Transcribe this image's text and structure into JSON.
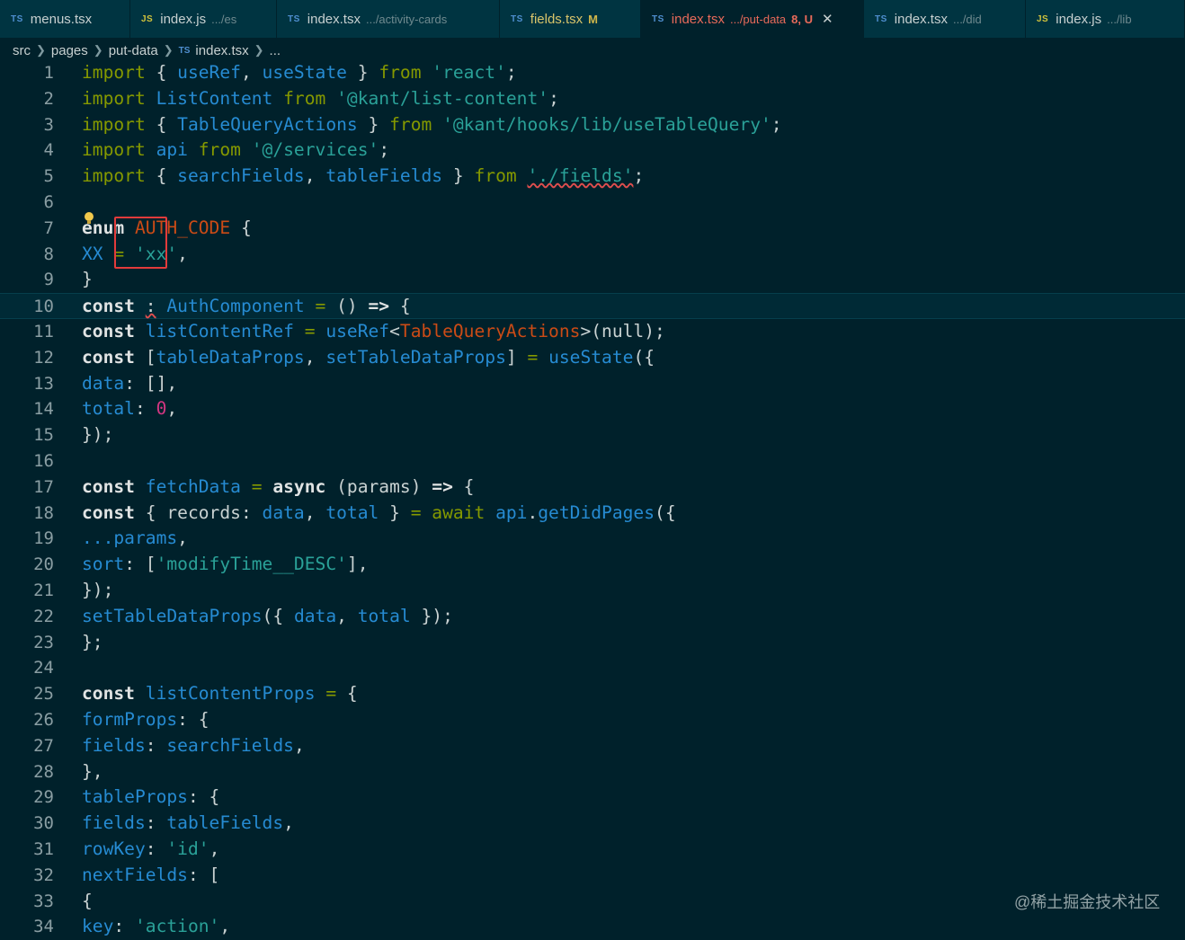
{
  "tabs": [
    {
      "lang": "TS",
      "name": "menus.tsx",
      "dir": "",
      "badge": "",
      "active": false
    },
    {
      "lang": "JS",
      "name": "index.js",
      "dir": ".../es",
      "badge": "",
      "active": false
    },
    {
      "lang": "TS",
      "name": "index.tsx",
      "dir": ".../activity-cards",
      "badge": "",
      "active": false
    },
    {
      "lang": "TS",
      "name": "fields.tsx",
      "dir": "",
      "badge": "M",
      "active": false
    },
    {
      "lang": "TS",
      "name": "index.tsx",
      "dir": ".../put-data",
      "badge": "8, U",
      "active": true
    },
    {
      "lang": "TS",
      "name": "index.tsx",
      "dir": ".../did",
      "badge": "",
      "active": false
    },
    {
      "lang": "JS",
      "name": "index.js",
      "dir": ".../lib",
      "badge": "",
      "active": false
    }
  ],
  "colors": {
    "modified": "#d0b64a",
    "error_tab": "#e86a5a",
    "fields_tab": "#d8c46a"
  },
  "breadcrumb": {
    "items": [
      "src",
      "pages",
      "put-data"
    ],
    "file_lang": "TS",
    "file": "index.tsx",
    "ellipsis": "..."
  },
  "code_lines": [
    [
      [
        "k",
        "import"
      ],
      [
        "p",
        " { "
      ],
      [
        "i",
        "useRef"
      ],
      [
        "p",
        ", "
      ],
      [
        "i",
        "useState"
      ],
      [
        "p",
        " } "
      ],
      [
        "k",
        "from"
      ],
      [
        "p",
        " "
      ],
      [
        "s",
        "'react'"
      ],
      [
        "p",
        ";"
      ]
    ],
    [
      [
        "k",
        "import"
      ],
      [
        "p",
        " "
      ],
      [
        "i",
        "ListContent"
      ],
      [
        "p",
        " "
      ],
      [
        "k",
        "from"
      ],
      [
        "p",
        " "
      ],
      [
        "s",
        "'@kant/list-content'"
      ],
      [
        "p",
        ";"
      ]
    ],
    [
      [
        "k",
        "import"
      ],
      [
        "p",
        " { "
      ],
      [
        "i",
        "TableQueryActions"
      ],
      [
        "p",
        " } "
      ],
      [
        "k",
        "from"
      ],
      [
        "p",
        " "
      ],
      [
        "s",
        "'@kant/hooks/lib/useTableQuery'"
      ],
      [
        "p",
        ";"
      ]
    ],
    [
      [
        "k",
        "import"
      ],
      [
        "p",
        " "
      ],
      [
        "i",
        "api"
      ],
      [
        "p",
        " "
      ],
      [
        "k",
        "from"
      ],
      [
        "p",
        " "
      ],
      [
        "s",
        "'@/services'"
      ],
      [
        "p",
        ";"
      ]
    ],
    [
      [
        "k",
        "import"
      ],
      [
        "p",
        " { "
      ],
      [
        "i",
        "searchFields"
      ],
      [
        "p",
        ", "
      ],
      [
        "i",
        "tableFields"
      ],
      [
        "p",
        " } "
      ],
      [
        "k",
        "from"
      ],
      [
        "p",
        " "
      ],
      [
        "s wav",
        "'./fields'"
      ],
      [
        "p",
        ";"
      ]
    ],
    [],
    [
      [
        "b",
        "enum"
      ],
      [
        "p",
        " "
      ],
      [
        "o",
        "AUTH_CODE"
      ],
      [
        "p",
        " {"
      ]
    ],
    [
      [
        "i",
        "XX"
      ],
      [
        "p",
        " "
      ],
      [
        "k",
        "="
      ],
      [
        "p",
        " "
      ],
      [
        "s",
        "'xx'"
      ],
      [
        "p",
        ","
      ]
    ],
    [
      [
        "p",
        "}"
      ]
    ],
    [
      [
        "b",
        "const"
      ],
      [
        "p",
        " "
      ],
      [
        "p wav",
        ":"
      ],
      [
        "p",
        " "
      ],
      [
        "i",
        "AuthComponent"
      ],
      [
        "p",
        " "
      ],
      [
        "k",
        "="
      ],
      [
        "p",
        " () "
      ],
      [
        "b",
        "=>"
      ],
      [
        "p",
        " {"
      ]
    ],
    [
      [
        "b",
        "const"
      ],
      [
        "p",
        " "
      ],
      [
        "i",
        "listContentRef"
      ],
      [
        "p",
        " "
      ],
      [
        "k",
        "="
      ],
      [
        "p",
        " "
      ],
      [
        "i",
        "useRef"
      ],
      [
        "p",
        "<"
      ],
      [
        "o",
        "TableQueryActions"
      ],
      [
        "p",
        ">(null);"
      ]
    ],
    [
      [
        "b",
        "const"
      ],
      [
        "p",
        " ["
      ],
      [
        "i",
        "tableDataProps"
      ],
      [
        "p",
        ", "
      ],
      [
        "i",
        "setTableDataProps"
      ],
      [
        "p",
        "] "
      ],
      [
        "k",
        "="
      ],
      [
        "p",
        " "
      ],
      [
        "i",
        "useState"
      ],
      [
        "p",
        "({"
      ]
    ],
    [
      [
        "i",
        "data"
      ],
      [
        "p",
        ": [],"
      ]
    ],
    [
      [
        "i",
        "total"
      ],
      [
        "p",
        ": "
      ],
      [
        "n",
        "0"
      ],
      [
        "p",
        ","
      ]
    ],
    [
      [
        "p",
        "});"
      ]
    ],
    [],
    [
      [
        "b",
        "const"
      ],
      [
        "p",
        " "
      ],
      [
        "i",
        "fetchData"
      ],
      [
        "p",
        " "
      ],
      [
        "k",
        "="
      ],
      [
        "p",
        " "
      ],
      [
        "b",
        "async"
      ],
      [
        "p",
        " (params) "
      ],
      [
        "b",
        "=>"
      ],
      [
        "p",
        " {"
      ]
    ],
    [
      [
        "b",
        "const"
      ],
      [
        "p",
        " { records: "
      ],
      [
        "i",
        "data"
      ],
      [
        "p",
        ", "
      ],
      [
        "i",
        "total"
      ],
      [
        "p",
        " } "
      ],
      [
        "k",
        "="
      ],
      [
        "p",
        " "
      ],
      [
        "k",
        "await"
      ],
      [
        "p",
        " "
      ],
      [
        "i",
        "api"
      ],
      [
        "p",
        "."
      ],
      [
        "i",
        "getDidPages"
      ],
      [
        "p",
        "({"
      ]
    ],
    [
      [
        "i",
        "...params"
      ],
      [
        "p",
        ","
      ]
    ],
    [
      [
        "i",
        "sort"
      ],
      [
        "p",
        ": ["
      ],
      [
        "s",
        "'modifyTime__DESC'"
      ],
      [
        "p",
        "],"
      ]
    ],
    [
      [
        "p",
        "});"
      ]
    ],
    [
      [
        "i",
        "setTableDataProps"
      ],
      [
        "p",
        "({ "
      ],
      [
        "i",
        "data"
      ],
      [
        "p",
        ", "
      ],
      [
        "i",
        "total"
      ],
      [
        "p",
        " });"
      ]
    ],
    [
      [
        "p",
        "};"
      ]
    ],
    [],
    [
      [
        "b",
        "const"
      ],
      [
        "p",
        " "
      ],
      [
        "i",
        "listContentProps"
      ],
      [
        "p",
        " "
      ],
      [
        "k",
        "="
      ],
      [
        "p",
        " {"
      ]
    ],
    [
      [
        "i",
        "formProps"
      ],
      [
        "p",
        ": {"
      ]
    ],
    [
      [
        "i",
        "fields"
      ],
      [
        "p",
        ": "
      ],
      [
        "i",
        "searchFields"
      ],
      [
        "p",
        ","
      ]
    ],
    [
      [
        "p",
        "},"
      ]
    ],
    [
      [
        "i",
        "tableProps"
      ],
      [
        "p",
        ": {"
      ]
    ],
    [
      [
        "i",
        "fields"
      ],
      [
        "p",
        ": "
      ],
      [
        "i",
        "tableFields"
      ],
      [
        "p",
        ","
      ]
    ],
    [
      [
        "i",
        "rowKey"
      ],
      [
        "p",
        ": "
      ],
      [
        "s",
        "'id'"
      ],
      [
        "p",
        ","
      ]
    ],
    [
      [
        "i",
        "nextFields"
      ],
      [
        "p",
        ": ["
      ]
    ],
    [
      [
        "p",
        "{"
      ]
    ],
    [
      [
        "i",
        "key"
      ],
      [
        "p",
        ": "
      ],
      [
        "s",
        "'action'"
      ],
      [
        "p",
        ","
      ]
    ]
  ],
  "current_line": 10,
  "watermark": "@稀土掘金技术社区"
}
